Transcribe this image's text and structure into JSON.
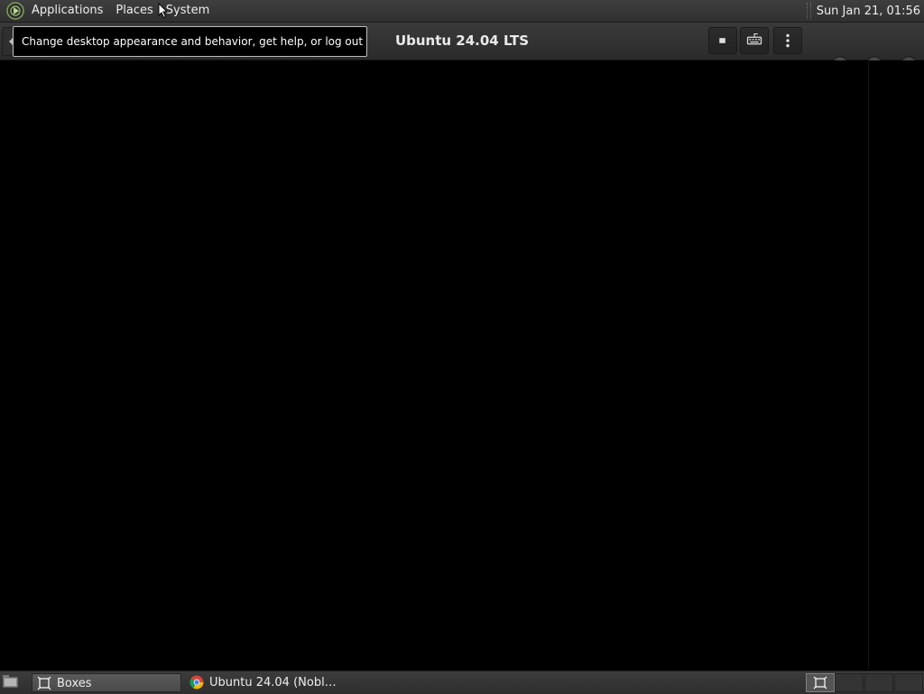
{
  "top_panel": {
    "menus": [
      "Applications",
      "Places",
      "System"
    ],
    "clock": "Sun Jan 21, 01:56",
    "logo_icon": "mate-logo-icon"
  },
  "headerbar": {
    "title": "Ubuntu 24.04 LTS",
    "buttons": {
      "back": "back-arrow-icon",
      "stop": "stop-icon",
      "keyboard": "keyboard-icon",
      "menu": "kebab-menu-icon"
    }
  },
  "tooltip": {
    "text": "Change desktop appearance and behavior, get help, or log out"
  },
  "taskbar": {
    "tasks": [
      {
        "label": "Boxes",
        "icon": "boxes-app-icon",
        "active": true
      },
      {
        "label": "Ubuntu 24.04 (Nobl…",
        "icon": "chrome-icon",
        "active": false
      }
    ],
    "workspace_icon": "boxes-app-icon"
  },
  "colors": {
    "panel": "#333333",
    "display": "#000000",
    "tooltip_border": "#bdbdbd"
  }
}
